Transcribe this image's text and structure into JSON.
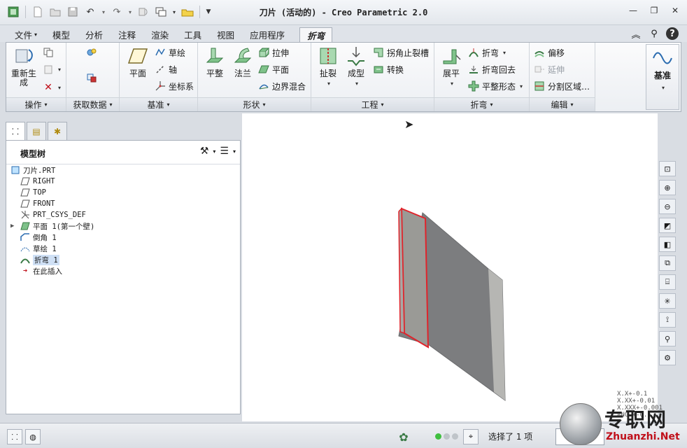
{
  "app": {
    "title": "刀片 (活动的) - Creo Parametric 2.0"
  },
  "tabs": [
    {
      "label": "文件",
      "arrow": "▾"
    },
    {
      "label": "模型"
    },
    {
      "label": "分析"
    },
    {
      "label": "注释"
    },
    {
      "label": "渲染"
    },
    {
      "label": "工具"
    },
    {
      "label": "视图"
    },
    {
      "label": "应用程序"
    },
    {
      "label": "折弯"
    }
  ],
  "ribbon": {
    "operations": {
      "regenerate": "重新生\n成",
      "group_label": "操作"
    },
    "getdata": {
      "group_label": "获取数据"
    },
    "datum": {
      "plane": "平面",
      "sketch": "草绘",
      "axis": "轴",
      "csys": "坐标系",
      "group_label": "基准"
    },
    "shapes": {
      "flat": "平整",
      "flange": "法兰",
      "extrude": "拉伸",
      "plane": "平面",
      "boundary_blend": "边界混合",
      "group_label": "形状"
    },
    "engineering": {
      "rip": "扯裂",
      "form": "成型",
      "corner_relief": "拐角止裂槽",
      "convert": "转换",
      "group_label": "工程"
    },
    "bend": {
      "unbend": "展平",
      "bend": "折弯",
      "bend_back": "折弯回去",
      "flat_pattern": "平整形态",
      "group_label": "折弯"
    },
    "editing": {
      "offset": "偏移",
      "extend": "延伸",
      "split_area": "分割区域…",
      "group_label": "编辑"
    },
    "datum_panel": {
      "label": "基准"
    }
  },
  "model_tree": {
    "title": "模型树",
    "items": [
      {
        "label": "刀片.PRT"
      },
      {
        "label": "RIGHT"
      },
      {
        "label": "TOP"
      },
      {
        "label": "FRONT"
      },
      {
        "label": "PRT_CSYS_DEF"
      },
      {
        "label": "平面 1(第一个壁)"
      },
      {
        "label": "倒角 1"
      },
      {
        "label": "草绘 1"
      },
      {
        "label": "折弯 1"
      },
      {
        "label": "在此插入"
      }
    ]
  },
  "status": {
    "selection": "选择了 1 项"
  },
  "viewport": {
    "tolerance": [
      "X.X+-0.1",
      "X.XX+-0.01",
      "X.XXX+-0.001",
      "ANG.+-0.5"
    ]
  },
  "watermark": {
    "cn": "专职网",
    "en": "Zhuanzhi.Net"
  },
  "colors": {
    "accent": "#2b6cb0",
    "highlight": "#e0242b",
    "part_gray": "#7c7d7f"
  }
}
